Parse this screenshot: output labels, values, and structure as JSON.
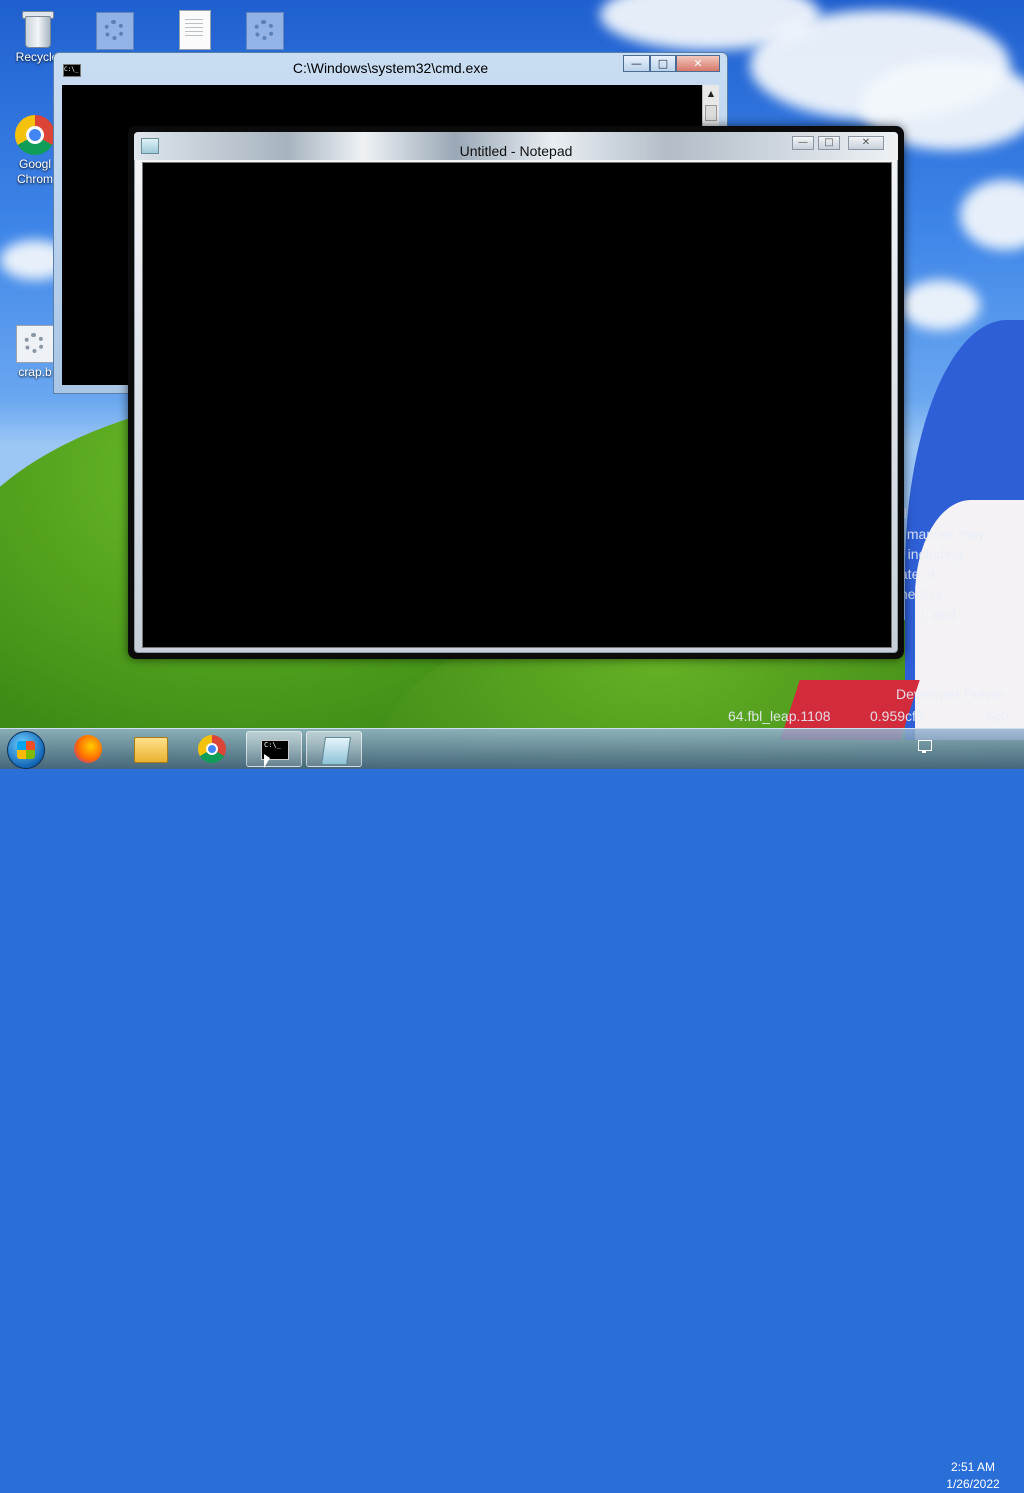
{
  "desktop": {
    "icons": [
      {
        "label": "Recycle",
        "name": "recycle-bin"
      },
      {
        "label": "Googl Chrom",
        "name": "google-chrome"
      },
      {
        "label": "crap.b",
        "name": "crap-batch-file"
      }
    ],
    "wallpaper_text": [
      "al",
      "y manner may",
      "d including",
      "tate of",
      "ment or",
      "), and",
      "Developer Previe",
      "64.fbl_leap.1108",
      "0.959cf9",
      "6c0"
    ]
  },
  "cmd_window": {
    "title": "C:\\Windows\\system32\\cmd.exe",
    "icon_text": "C:\\_",
    "buttons": {
      "minimize": "—",
      "maximize": "□",
      "close": "✕"
    }
  },
  "notepad_window": {
    "title": "Untitled - Notepad",
    "buttons": {
      "minimize": "—",
      "maximize": "□",
      "close": "✕"
    }
  },
  "taskbar": {
    "items": [
      {
        "name": "firefox",
        "active": false
      },
      {
        "name": "file-explorer",
        "active": false
      },
      {
        "name": "chrome",
        "active": false
      },
      {
        "name": "cmd",
        "active": true,
        "icon_text": "C:\\_"
      },
      {
        "name": "notepad",
        "active": true
      }
    ],
    "clock": {
      "time": "2:51 AM",
      "date": "1/26/2022"
    }
  },
  "colors": {
    "console_bg": "#000000",
    "taskbar": "#5a7c9e",
    "sky": "#3f86e8"
  }
}
